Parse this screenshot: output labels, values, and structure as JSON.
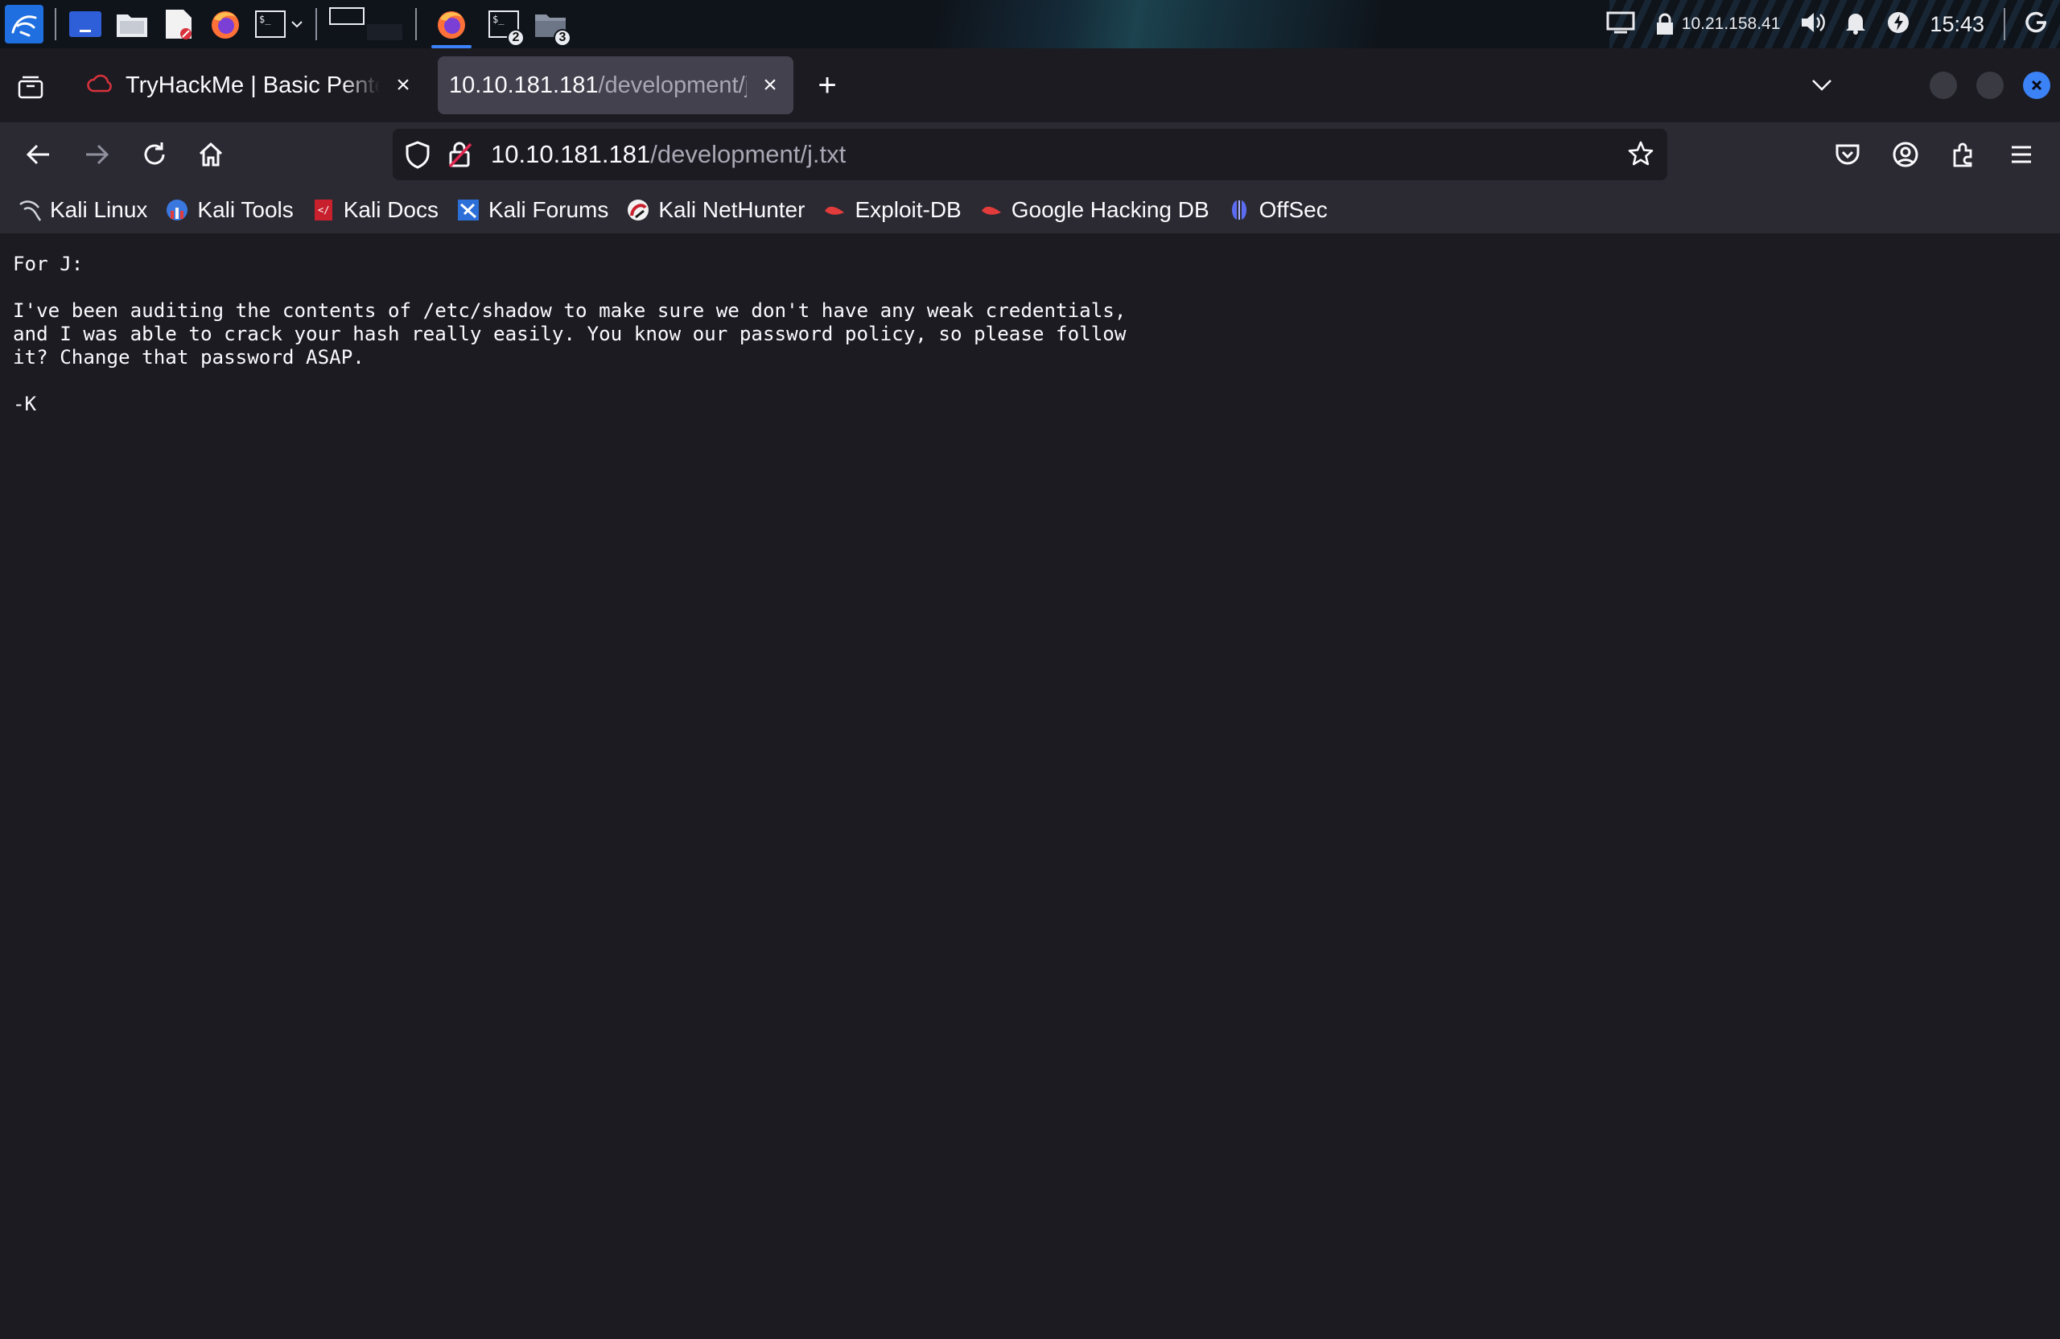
{
  "taskbar": {
    "apps": [
      {
        "name": "kali-menu-icon"
      },
      {
        "name": "show-desktop-icon"
      },
      {
        "name": "file-manager-icon"
      },
      {
        "name": "text-editor-icon"
      },
      {
        "name": "firefox-launcher-icon"
      },
      {
        "name": "terminal-launcher-icon"
      }
    ],
    "windows": [
      {
        "name": "firefox-window-icon"
      },
      {
        "name": "terminal-window-icon",
        "count": "2"
      },
      {
        "name": "folder-window-icon",
        "count": "3"
      }
    ],
    "vpn_ip": "10.21.158.41",
    "clock": "15:43"
  },
  "tabs": [
    {
      "title": "TryHackMe | Basic Pentesting",
      "icon": "tryhackme-icon",
      "close": "×",
      "active": false
    },
    {
      "title_host": "10.10.181.181",
      "title_path": "/development/j.txt",
      "close": "×",
      "active": true
    }
  ],
  "new_tab_label": "+",
  "urlbar": {
    "host": "10.10.181.181",
    "path": "/development/j.txt"
  },
  "bookmarks": [
    {
      "label": "Kali Linux",
      "icon": "kali-dragon-icon"
    },
    {
      "label": "Kali Tools",
      "icon": "kali-tools-icon"
    },
    {
      "label": "Kali Docs",
      "icon": "kali-docs-icon"
    },
    {
      "label": "Kali Forums",
      "icon": "kali-forums-icon"
    },
    {
      "label": "Kali NetHunter",
      "icon": "nethunter-icon"
    },
    {
      "label": "Exploit-DB",
      "icon": "exploitdb-icon"
    },
    {
      "label": "Google Hacking DB",
      "icon": "ghdb-icon"
    },
    {
      "label": "OffSec",
      "icon": "offsec-icon"
    }
  ],
  "document": {
    "text": "For J:\n\nI've been auditing the contents of /etc/shadow to make sure we don't have any weak credentials,\nand I was able to crack your hash really easily. You know our password policy, so please follow\nit? Change that password ASAP.\n\n-K"
  },
  "colors": {
    "accent": "#3b82f6",
    "toolbar": "#2b2a33",
    "page_bg": "#1c1b22",
    "active_tab": "#42414d"
  }
}
